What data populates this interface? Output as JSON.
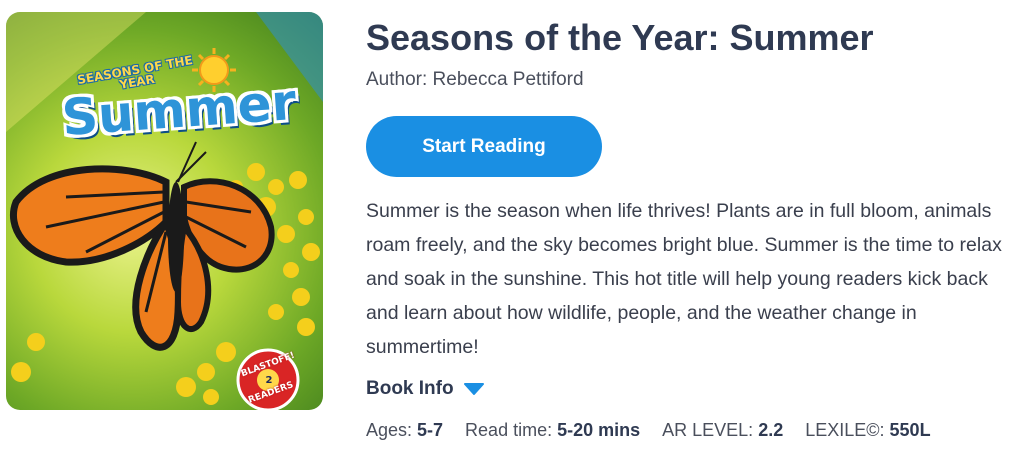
{
  "book": {
    "title": "Seasons of the Year: Summer",
    "author": "Author: Rebecca Pettiford",
    "start_reading_label": "Start Reading",
    "description": "Summer is the season when life thrives! Plants are in full bloom, animals roam freely, and the sky becomes bright blue. Summer is the time to relax and soak in the sunshine. This hot title will help young readers kick back and learn about how wildlife, people, and the weather change in summertime!",
    "book_info_label": "Book Info",
    "book_info_icon": "caret-down-icon",
    "cover": {
      "series_text": "SEASONS OF THE YEAR",
      "title_text": "Summer",
      "badge_top": "BLASTOFF!",
      "badge_level": "2",
      "badge_bottom": "READERS"
    }
  },
  "meta": {
    "ages_label": "Ages:",
    "ages_value": "5-7",
    "read_time_label": "Read time:",
    "read_time_value": "5-20 mins",
    "ar_level_label": "AR LEVEL:",
    "ar_level_value": "2.2",
    "lexile_label": "LEXILE©:",
    "lexile_value": "550L"
  },
  "colors": {
    "accent": "#1a8fe3",
    "title_text": "#2f3a52",
    "body_text": "#3a3f4d"
  }
}
